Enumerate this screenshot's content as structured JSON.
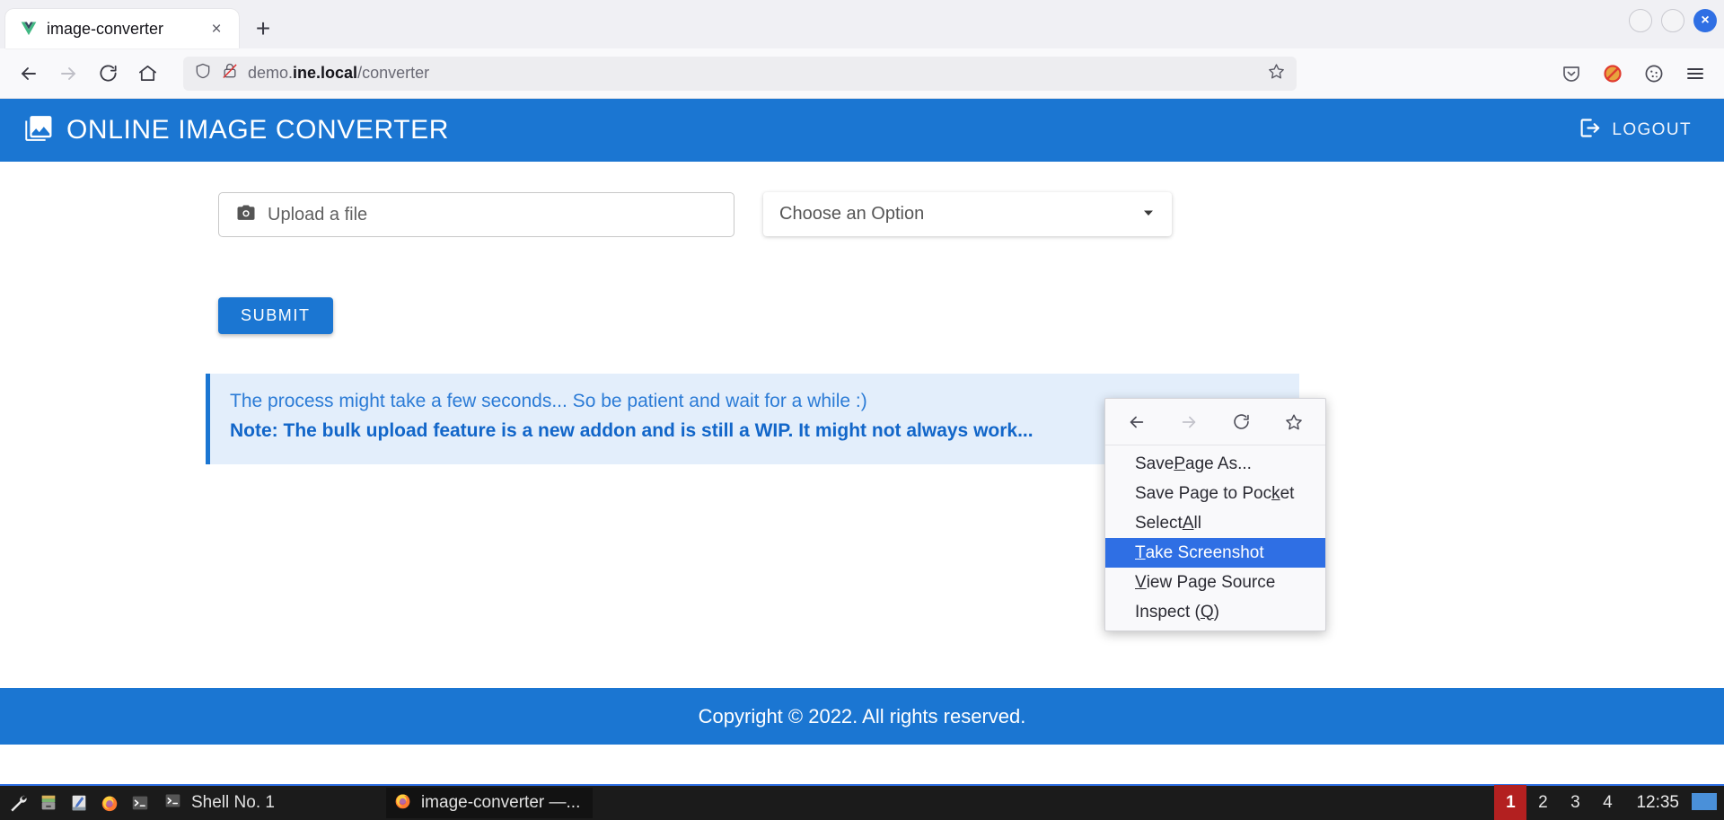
{
  "browser": {
    "tab": {
      "title": "image-converter",
      "favicon": "vue-logo-icon",
      "close_label": "×"
    },
    "new_tab_label": "+",
    "window_controls": {
      "minimize": "minimize-button",
      "maximize": "maximize-button",
      "close_label": "×"
    },
    "nav": {
      "back": "back-button",
      "forward": "forward-button",
      "reload": "reload-button",
      "home": "home-button"
    },
    "url": {
      "prefix": "demo.",
      "domain": "ine.local",
      "path": "/converter",
      "shield_icon": "shield-icon",
      "lock_icon": "lock-crossed-icon",
      "bookmark_icon": "star-icon"
    },
    "toolbar_right": {
      "pocket": "pocket-icon",
      "adblock": "adblock-icon",
      "cookies": "cookie-icon",
      "menu": "hamburger-menu-icon"
    }
  },
  "app": {
    "header": {
      "icon": "image-library-icon",
      "title": "ONLINE IMAGE CONVERTER",
      "logout_label": "LOGOUT",
      "logout_icon": "logout-icon",
      "background": "#1b76d2"
    },
    "form": {
      "upload": {
        "label": "Upload a file",
        "icon": "camera-icon"
      },
      "select": {
        "value": "Choose an Option",
        "caret_icon": "chevron-down-icon"
      },
      "submit_label": "SUBMIT"
    },
    "alert": {
      "line1": "The process might take a few seconds... So be patient and wait for a while :)",
      "line2": "Note: The bulk upload feature is a new addon and is still a WIP. It might not always work...",
      "accent": "#1b76d2",
      "background": "#e3eefb"
    },
    "footer": {
      "text": "Copyright © 2022. All rights reserved."
    }
  },
  "context_menu": {
    "nav": {
      "back": "back-button",
      "forward": "forward-button",
      "reload": "reload-button",
      "bookmark": "star-button"
    },
    "items": [
      {
        "label": "Save Page As...",
        "accel": "P",
        "selected": false
      },
      {
        "label": "Save Page to Pocket",
        "accel": "k",
        "selected": false
      },
      {
        "label": "Select All",
        "accel": "A",
        "selected": false
      },
      {
        "label": "Take Screenshot",
        "accel": "T",
        "selected": true
      },
      {
        "label": "View Page Source",
        "accel": "V",
        "selected": false
      },
      {
        "label": "Inspect (Q)",
        "accel": "Q",
        "selected": false
      }
    ],
    "highlight_color": "#2f6fe4"
  },
  "taskbar": {
    "launchers": [
      "wrench-icon",
      "file-manager-icon",
      "text-editor-icon",
      "firefox-icon",
      "terminal-icon"
    ],
    "windows": [
      {
        "label": "Shell No. 1",
        "icon": "terminal-icon",
        "active": true
      },
      {
        "label": "image-converter —...",
        "icon": "firefox-icon",
        "active": false
      }
    ],
    "workspaces": [
      "1",
      "2",
      "3",
      "4"
    ],
    "active_workspace": "1",
    "clock": "12:35",
    "tray_icon": "display-icon",
    "active_color": "#b32020"
  }
}
